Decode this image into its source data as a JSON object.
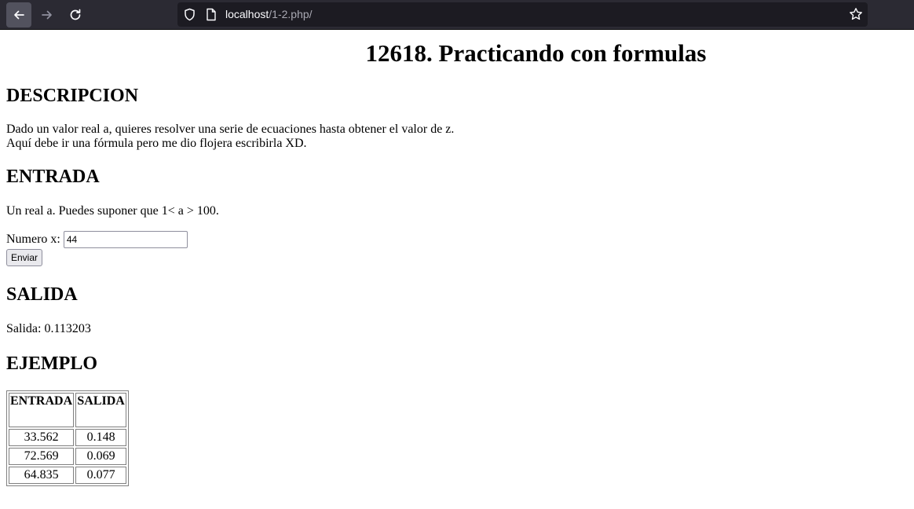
{
  "browser": {
    "url_host": "localhost",
    "url_path": "/1-2.php/"
  },
  "page": {
    "title": "12618. Practicando con formulas",
    "descripcion": {
      "heading": "DESCRIPCION",
      "line1": "Dado un valor real a, quieres resolver una serie de ecuaciones hasta obtener el valor de z.",
      "line2": "Aquí debe ir una fórmula pero me dio flojera escribirla XD."
    },
    "entrada": {
      "heading": "ENTRADA",
      "text": "Un real a. Puedes suponer que 1< a > 100."
    },
    "form": {
      "label": "Numero x:",
      "value": "44",
      "submit_label": "Enviar"
    },
    "salida": {
      "heading": "SALIDA",
      "text": "Salida: 0.113203"
    },
    "ejemplo": {
      "heading": "EJEMPLO",
      "headers": [
        "ENTRADA",
        "SALIDA"
      ],
      "rows": [
        [
          "33.562",
          "0.148"
        ],
        [
          "72.569",
          "0.069"
        ],
        [
          "64.835",
          "0.077"
        ]
      ]
    }
  }
}
